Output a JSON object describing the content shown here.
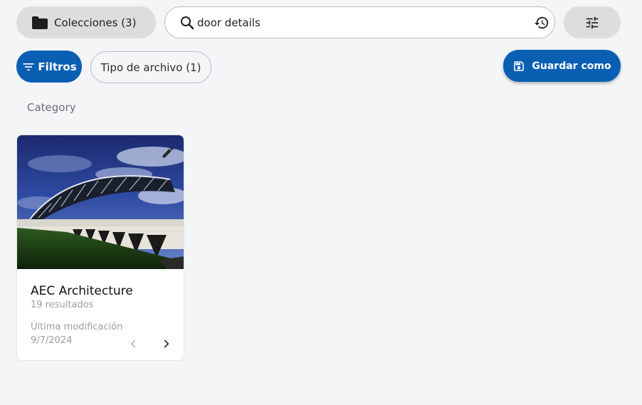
{
  "toolbar": {
    "collections_label": "Colecciones (3)",
    "search_value": "door details",
    "folder_icon": "folder-icon",
    "search_icon": "search-icon",
    "history_icon": "history-icon",
    "tune_icon": "tune-icon"
  },
  "filters": {
    "filters_label": "Filtros",
    "filetype_chip": "Tipo de archivo (1)",
    "save_as_label": "Guardar como",
    "filter_icon": "filter-list-icon",
    "save_icon": "floppy-disk-icon"
  },
  "section": {
    "category_label": "Category"
  },
  "card": {
    "title": "AEC Architecture",
    "results": "19 resultados",
    "modified_label": "Última modificación",
    "modified_date": "9/7/2024",
    "edit_icon": "pencil-icon",
    "prev_icon": "chevron-left-icon",
    "next_icon": "chevron-right-icon"
  },
  "colors": {
    "primary": "#0a5fb3",
    "chip_bg": "#dcdddf",
    "page_bg": "#f4f5f7"
  }
}
